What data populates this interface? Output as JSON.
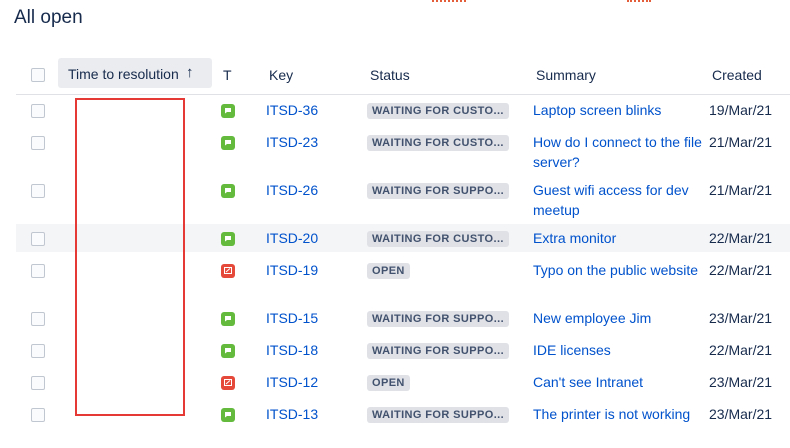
{
  "page": {
    "title": "All open"
  },
  "table": {
    "columns": {
      "time_to_resolution": "Time to resolution",
      "sort_arrow": "↑",
      "type": "T",
      "key": "Key",
      "status": "Status",
      "summary": "Summary",
      "created": "Created"
    },
    "rows": [
      {
        "type": "comment-icon",
        "key": "ITSD-36",
        "status": "WAITING FOR CUSTO...",
        "summary": "Laptop screen blinks",
        "created": "19/Mar/21"
      },
      {
        "type": "comment-icon",
        "key": "ITSD-23",
        "status": "WAITING FOR CUSTO...",
        "summary": "How do I connect to the file server?",
        "created": "21/Mar/21"
      },
      {
        "type": "comment-icon",
        "key": "ITSD-26",
        "status": "WAITING FOR SUPPO...",
        "summary": "Guest wifi access for dev meetup",
        "created": "21/Mar/21"
      },
      {
        "type": "comment-icon",
        "key": "ITSD-20",
        "status": "WAITING FOR CUSTO...",
        "summary": "Extra monitor",
        "created": "22/Mar/21"
      },
      {
        "type": "incident-icon",
        "key": "ITSD-19",
        "status": "OPEN",
        "summary": "Typo on the public website",
        "created": "22/Mar/21"
      },
      {
        "type": "comment-icon",
        "key": "ITSD-15",
        "status": "WAITING FOR SUPPO...",
        "summary": "New employee Jim",
        "created": "23/Mar/21"
      },
      {
        "type": "comment-icon",
        "key": "ITSD-18",
        "status": "WAITING FOR SUPPO...",
        "summary": "IDE licenses",
        "created": "22/Mar/21"
      },
      {
        "type": "incident-icon",
        "key": "ITSD-12",
        "status": "OPEN",
        "summary": "Can't see Intranet",
        "created": "23/Mar/21"
      },
      {
        "type": "comment-icon",
        "key": "ITSD-13",
        "status": "WAITING FOR SUPPO...",
        "summary": "The printer is not working",
        "created": "23/Mar/21"
      }
    ]
  },
  "colors": {
    "link": "#0052cc",
    "comment_icon": "#63ba3c",
    "incident_icon": "#e5493a",
    "highlight_row": "#f4f5f7",
    "redaction_box": "#e53935"
  }
}
